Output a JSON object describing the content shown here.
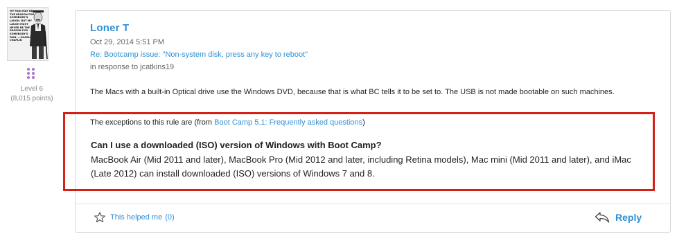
{
  "author": {
    "name": "Loner T",
    "level": "Level 6",
    "points": "(8,015 points)",
    "avatar_quote": "MY PAIN MAY BE THE REASON FOR SOMEBODY'S LAUGH. BUT MY LAUGH MUST NEVER BE THE REASON FOR SOMEBODY'S PAIN. —CHARLIE CHAPLIN"
  },
  "post": {
    "date": "Oct 29, 2014 5:51 PM",
    "reply_to_title": "Re: Bootcamp issue: \"Non-system disk, press any key to reboot\"",
    "in_response_to": "in response to jcatkins19",
    "body": "The Macs with a built-in Optical drive use the Windows DVD, because that is what BC tells it to be set to. The USB is not made bootable on such machines.",
    "exceptions_prefix": "The exceptions to this rule are (from ",
    "exceptions_link": "Boot Camp 5.1: Frequently asked questions",
    "exceptions_suffix": ")",
    "faq_question": "Can I use a downloaded (ISO) version of Windows with Boot Camp?",
    "faq_answer": "MacBook Air (Mid 2011 and later), MacBook Pro (Mid 2012 and later, including Retina models), Mac mini (Mid 2011 and later), and iMac (Late 2012) can install downloaded (ISO) versions of Windows 7 and 8."
  },
  "actions": {
    "helped_label": "This helped me",
    "helped_count": "(0)",
    "reply_label": "Reply"
  },
  "colors": {
    "link": "#2f8fd3",
    "highlight": "#d32118",
    "level_dots": "#a674c8"
  }
}
